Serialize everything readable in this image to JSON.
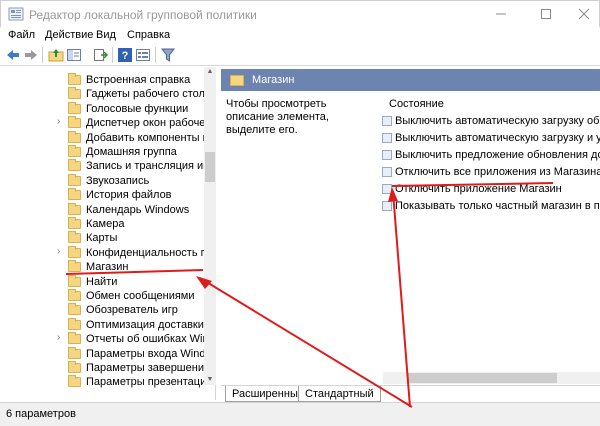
{
  "window": {
    "title": "Редактор локальной групповой политики",
    "minimize_icon": "minimize-icon",
    "maximize_icon": "maximize-icon",
    "close_icon": "close-icon"
  },
  "menu": {
    "items": [
      "Файл",
      "Действие",
      "Вид",
      "Справка"
    ]
  },
  "toolbar": {
    "icons": [
      "back-arrow-icon",
      "forward-arrow-icon",
      "up-folder-icon",
      "show-hide-tree-icon",
      "export-list-icon",
      "help-icon",
      "properties-icon",
      "filter-icon"
    ]
  },
  "tree": {
    "items": [
      {
        "label": "Встроенная справка",
        "expandable": false
      },
      {
        "label": "Гаджеты рабочего стола",
        "expandable": false
      },
      {
        "label": "Голосовые функции",
        "expandable": false
      },
      {
        "label": "Диспетчер окон рабочего ст",
        "expandable": true
      },
      {
        "label": "Добавить компоненты в W",
        "expandable": false
      },
      {
        "label": "Домашняя группа",
        "expandable": false
      },
      {
        "label": "Запись и трансляция игр W",
        "expandable": false
      },
      {
        "label": "Звукозапись",
        "expandable": false
      },
      {
        "label": "История файлов",
        "expandable": false
      },
      {
        "label": "Календарь Windows",
        "expandable": false
      },
      {
        "label": "Камера",
        "expandable": false
      },
      {
        "label": "Карты",
        "expandable": false
      },
      {
        "label": "Конфиденциальность прил",
        "expandable": true
      },
      {
        "label": "Магазин",
        "expandable": false,
        "selected": true
      },
      {
        "label": "Найти",
        "expandable": false
      },
      {
        "label": "Обмен сообщениями",
        "expandable": false
      },
      {
        "label": "Обозреватель игр",
        "expandable": false
      },
      {
        "label": "Оптимизация доставки",
        "expandable": false
      },
      {
        "label": "Отчеты об ошибках Windo",
        "expandable": true
      },
      {
        "label": "Параметры входа Windows",
        "expandable": false
      },
      {
        "label": "Параметры завершения раб",
        "expandable": false
      },
      {
        "label": "Параметры презентации",
        "expandable": false
      }
    ]
  },
  "right_pane": {
    "header_title": "Магазин",
    "description": "Чтобы просмотреть описание элемента, выделите его.",
    "column_header": "Состояние",
    "settings": [
      "Выключить автоматическую загрузку обновлений",
      "Выключить автоматическую загрузку и установку",
      "Выключить предложение обновления до последней",
      "Отключить все приложения из Магазина Windows",
      "Отключить приложение Магазин",
      "Показывать только частный магазин в приложении"
    ]
  },
  "tabs": {
    "extended": "Расширенный",
    "standard": "Стандартный"
  },
  "status": {
    "text": "6 параметров"
  },
  "colors": {
    "annotation_red": "#e01b1b",
    "header_blue": "#6e84b0"
  }
}
